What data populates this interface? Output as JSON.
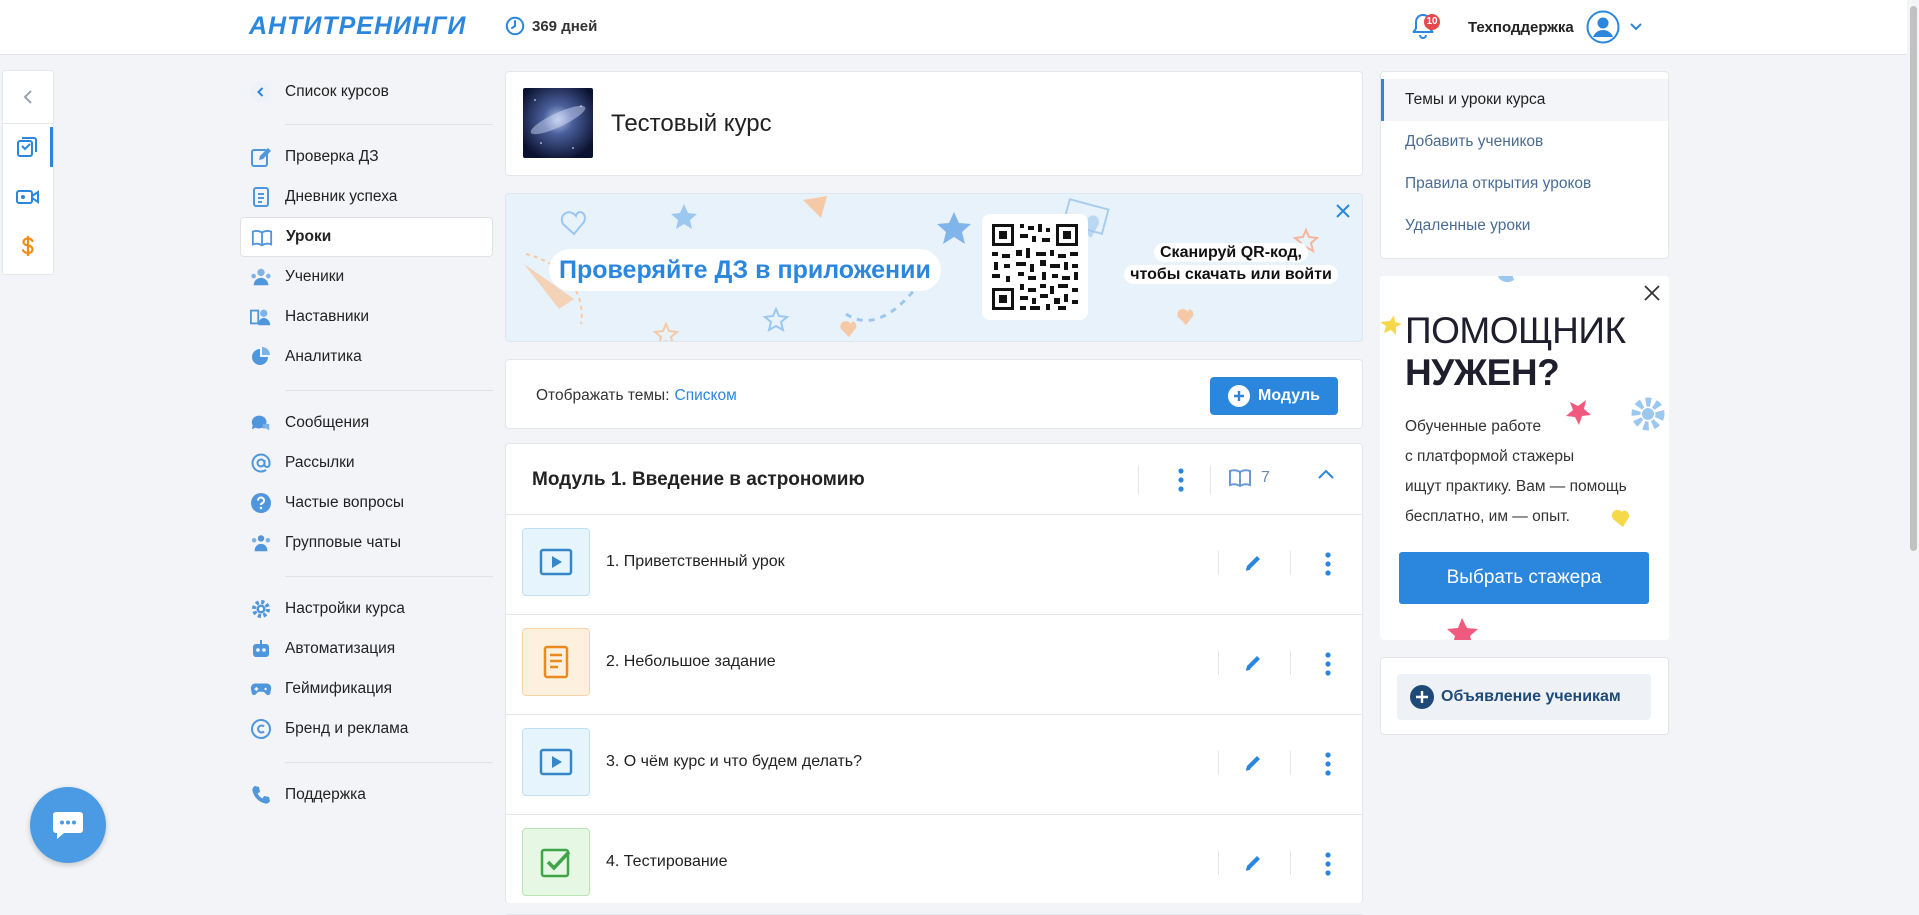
{
  "header": {
    "logo_text": "АНТИТРЕНИНГИ",
    "days_label": "369 дней",
    "notifications_count": "10",
    "support_label": "Техподдержка"
  },
  "left_nav": {
    "back_label": "Список курсов",
    "items": [
      {
        "label": "Проверка ДЗ",
        "icon": "pencil-square-icon"
      },
      {
        "label": "Дневник успеха",
        "icon": "diary-icon"
      },
      {
        "label": "Уроки",
        "icon": "open-book-icon",
        "active": true
      },
      {
        "label": "Ученики",
        "icon": "students-icon"
      },
      {
        "label": "Наставники",
        "icon": "mentors-icon"
      },
      {
        "label": "Аналитика",
        "icon": "pie-chart-icon"
      },
      {
        "label": "Сообщения",
        "icon": "chat-bubbles-icon"
      },
      {
        "label": "Рассылки",
        "icon": "at-sign-icon"
      },
      {
        "label": "Частые вопросы",
        "icon": "question-icon"
      },
      {
        "label": "Групповые чаты",
        "icon": "group-icon"
      },
      {
        "label": "Настройки курса",
        "icon": "gear-icon"
      },
      {
        "label": "Автоматизация",
        "icon": "robot-icon"
      },
      {
        "label": "Геймификация",
        "icon": "gamepad-icon"
      },
      {
        "label": "Бренд и реклама",
        "icon": "copyright-icon"
      },
      {
        "label": "Поддержка",
        "icon": "phone-icon"
      }
    ]
  },
  "course": {
    "title": "Тестовый курс"
  },
  "promo": {
    "headline": "Проверяйте ДЗ в приложении",
    "scan_line1": "Сканируй QR-код,",
    "scan_line2": "чтобы скачать или войти"
  },
  "topics": {
    "label": "Отображать темы:",
    "mode": "Списком",
    "add_module_label": "Модуль"
  },
  "module": {
    "title": "Модуль 1. Введение в астрономию",
    "lessons_count": "7",
    "lessons": [
      {
        "title": "1. Приветственный урок",
        "type": "video-icon"
      },
      {
        "title": "2. Небольшое задание",
        "type": "task-icon"
      },
      {
        "title": "3. О чём курс и что будем делать?",
        "type": "video-icon"
      },
      {
        "title": "4. Тестирование",
        "type": "test-icon"
      }
    ]
  },
  "right_nav": {
    "items": [
      {
        "label": "Темы и уроки курса",
        "active": true
      },
      {
        "label": "Добавить учеников"
      },
      {
        "label": "Правила открытия уроков"
      },
      {
        "label": "Удаленные уроки"
      }
    ]
  },
  "helper": {
    "title_line1": "ПОМОЩНИК",
    "title_line2": "НУЖЕН?",
    "text_line1": "Обученные работе",
    "text_line2": "с платформой стажеры",
    "text_line3": "ищут практику. Вам — помощь",
    "text_line4": "бесплатно, им — опыт.",
    "cta_label": "Выбрать стажера"
  },
  "announce": {
    "label": "Объявление ученикам"
  },
  "colors": {
    "accent": "#2b86dd",
    "background": "#f2f4f7"
  }
}
